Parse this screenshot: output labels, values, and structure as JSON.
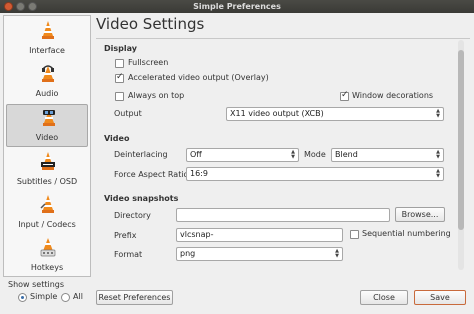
{
  "window": {
    "title": "Simple Preferences"
  },
  "sidebar": {
    "items": [
      {
        "label": "Interface"
      },
      {
        "label": "Audio"
      },
      {
        "label": "Video"
      },
      {
        "label": "Subtitles / OSD"
      },
      {
        "label": "Input / Codecs"
      },
      {
        "label": "Hotkeys"
      }
    ],
    "active": "Video"
  },
  "show_settings": {
    "label": "Show settings",
    "simple": "Simple",
    "all": "All",
    "selected": "Simple"
  },
  "page": {
    "title": "Video Settings"
  },
  "display": {
    "section": "Display",
    "fullscreen": {
      "label": "Fullscreen",
      "checked": false
    },
    "accelerated": {
      "label": "Accelerated video output (Overlay)",
      "checked": true
    },
    "always_on_top": {
      "label": "Always on top",
      "checked": false
    },
    "window_decorations": {
      "label": "Window decorations",
      "checked": true
    },
    "output_label": "Output",
    "output_value": "X11 video output (XCB)"
  },
  "video": {
    "section": "Video",
    "deinterlacing_label": "Deinterlacing",
    "deinterlacing_value": "Off",
    "mode_label": "Mode",
    "mode_value": "Blend",
    "aspect_label": "Force Aspect Ratio",
    "aspect_value": "16:9"
  },
  "snapshots": {
    "section": "Video snapshots",
    "directory_label": "Directory",
    "directory_value": "",
    "browse_label": "Browse...",
    "prefix_label": "Prefix",
    "prefix_value": "vlcsnap-",
    "sequential_label": "Sequential numbering",
    "format_label": "Format",
    "format_value": "png"
  },
  "footer": {
    "reset": "Reset Preferences",
    "close": "Close",
    "save": "Save"
  },
  "colors": {
    "accent": "#e8781e",
    "title_bar": "#3c3c38"
  }
}
